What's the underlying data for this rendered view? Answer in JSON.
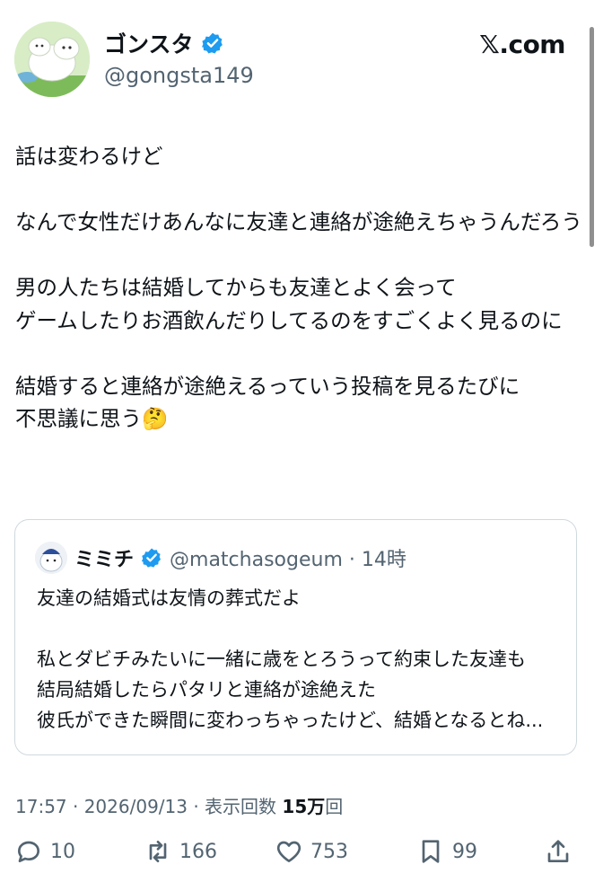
{
  "brand": "𝕏.com",
  "author": {
    "display_name": "ゴンスタ",
    "handle": "@gongsta149"
  },
  "tweet": {
    "lines": [
      "話は変わるけど",
      "",
      "なんで女性だけあんなに友達と連絡が途絶えちゃうんだろう",
      "",
      "男の人たちは結婚してからも友達とよく会って",
      "ゲームしたりお酒飲んだりしてるのをすごくよく見るのに",
      "",
      "結婚すると連絡が途絶えるっていう投稿を見るたびに",
      "不思議に思う🤔"
    ]
  },
  "quote": {
    "display_name": "ミミチ",
    "handle_time": "@matchasogeum · 14時",
    "lines": [
      "友達の結婚式は友情の葬式だよ",
      "",
      "私とダビチみたいに一緒に歳をとろうって約束した友達も",
      "結局結婚したらパタリと連絡が途絶えた",
      "彼氏ができた瞬間に変わっちゃったけど、結婚となるとね..."
    ]
  },
  "meta": {
    "time_date": "17:57 · 2026/09/13 · 表示回数 ",
    "views": "15万",
    "views_suffix": "回"
  },
  "actions": {
    "reply_count": "10",
    "retweet_count": "166",
    "like_count": "753",
    "bookmark_count": "99"
  },
  "colors": {
    "verified": "#1d9bf0",
    "secondary_text": "#536471",
    "border": "#cfd9de"
  }
}
